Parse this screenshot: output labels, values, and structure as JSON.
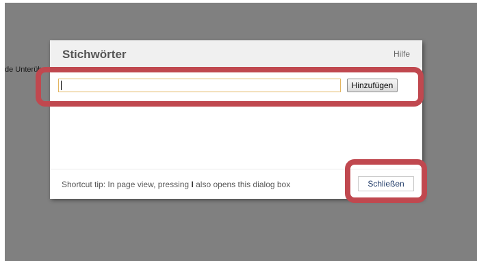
{
  "background": {
    "partial_text": "de Unterüb"
  },
  "dialog": {
    "title": "Stichwörter",
    "help_label": "Hilfe",
    "tag_input": {
      "value": "",
      "placeholder": ""
    },
    "add_button_label": "Hinzufügen",
    "footer": {
      "shortcut_prefix": "Shortcut tip: In page view, pressing ",
      "shortcut_key": "I",
      "shortcut_suffix": " also opens this dialog box",
      "close_button_label": "Schließen"
    }
  },
  "colors": {
    "overlay": "#808080",
    "highlight": "#c0484f",
    "input_border": "#e3b560",
    "close_text": "#1f3a68"
  }
}
